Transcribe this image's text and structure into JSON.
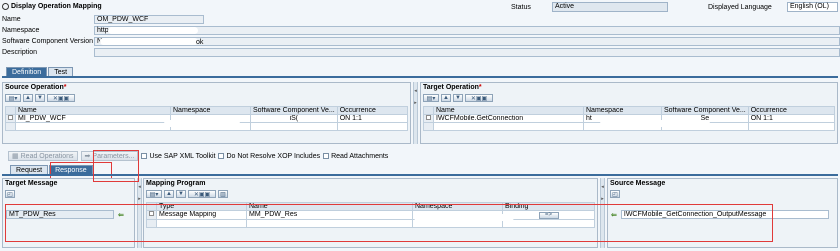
{
  "header": {
    "title": "Display Operation Mapping",
    "status_label": "Status",
    "status_value": "Active",
    "language_label": "Displayed Language",
    "language_value": "English (OL)"
  },
  "fields": {
    "name_label": "Name",
    "name_value": "OM_PDW_WCF",
    "namespace_label": "Namespace",
    "namespace_value": "http",
    "swcv_label": "Software Component Version",
    "swcv_value_prefix": "N",
    "swcv_value_suffix": "ok",
    "description_label": "Description",
    "description_value": ""
  },
  "main_tabs": [
    "Definition",
    "Test"
  ],
  "source_operation": {
    "title": "Source Operation",
    "columns": [
      "Name",
      "Namespace",
      "Software Component Ve...",
      "Occurrence"
    ],
    "rows": [
      {
        "name": "MI_PDW_WCF",
        "namespace": "",
        "swcv": "iS(",
        "occurrence": "ON 1:1"
      }
    ]
  },
  "target_operation": {
    "title": "Target Operation",
    "columns": [
      "Name",
      "Namespace",
      "Software Component Ve...",
      "Occurrence"
    ],
    "rows": [
      {
        "name": "IWCFMobile.GetConnection",
        "namespace": "ht",
        "swcv": "Se",
        "occurrence": "ON 1:1"
      }
    ]
  },
  "actions": {
    "read_operations": "Read Operations",
    "parameters": "Parameters...",
    "use_sap_xml_toolkit": "Use SAP XML Toolkit",
    "do_not_resolve_xop": "Do Not Resolve XOP Includes",
    "read_attachments": "Read Attachments"
  },
  "sub_tabs": [
    "Request",
    "Response"
  ],
  "target_message": {
    "title": "Target Message",
    "value": "MT_PDW_Res"
  },
  "mapping_program": {
    "title": "Mapping Program",
    "columns": [
      "Type",
      "Name",
      "Namespace",
      "Binding"
    ],
    "rows": [
      {
        "type": "Message Mapping",
        "name": "MM_PDW_Res",
        "namespace": "",
        "binding": "=>"
      }
    ]
  },
  "source_message": {
    "title": "Source Message",
    "value": "IWCFMobile_GetConnection_OutputMessage"
  }
}
